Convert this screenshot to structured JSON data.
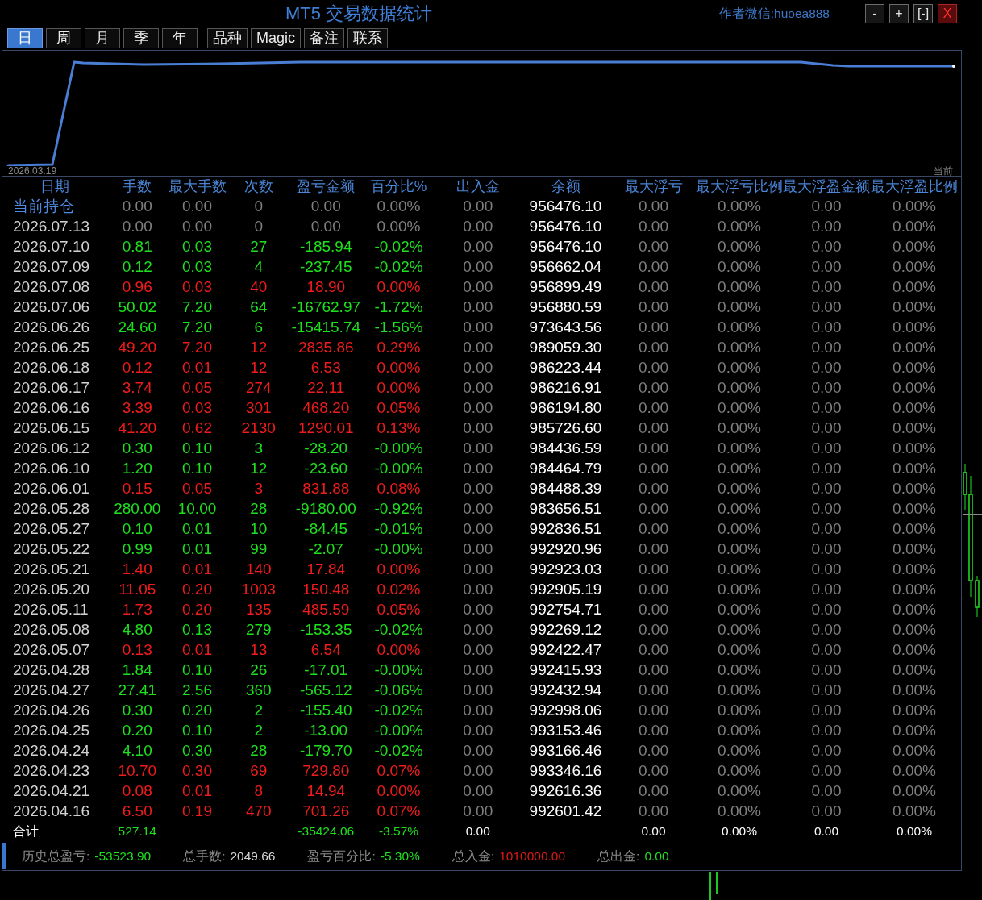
{
  "window": {
    "title": "MT5 交易数据统计",
    "author": "作者微信:huoea888",
    "controls": [
      {
        "label": "-",
        "kind": "minus"
      },
      {
        "label": "+",
        "kind": "plus"
      },
      {
        "label": "[-]",
        "kind": "collapse"
      },
      {
        "label": "X",
        "kind": "close"
      }
    ]
  },
  "period_tabs": [
    {
      "label": "日",
      "selected": true
    },
    {
      "label": "周",
      "selected": false
    },
    {
      "label": "月",
      "selected": false
    },
    {
      "label": "季",
      "selected": false
    },
    {
      "label": "年",
      "selected": false
    }
  ],
  "function_buttons": [
    "品种",
    "Magic",
    "备注",
    "联系"
  ],
  "chart": {
    "start_label": "2026.03.19",
    "end_label": "当前"
  },
  "table": {
    "columns": [
      "日期",
      "手数",
      "最大手数",
      "次数",
      "盈亏金额",
      "百分比%",
      "出入金",
      "余额",
      "最大浮亏",
      "最大浮亏比例",
      "最大浮盈金额",
      "最大浮盈比例"
    ],
    "rows": [
      {
        "kind": "current",
        "color": "#7f7f7f",
        "cells": [
          "当前持仓",
          "0.00",
          "0.00",
          "0",
          "0.00",
          "0.00%",
          "0.00",
          "956476.10",
          "0.00",
          "0.00%",
          "0.00",
          "0.00%"
        ]
      },
      {
        "kind": "day",
        "color": "#7f7f7f",
        "cells": [
          "2026.07.13",
          "0.00",
          "0.00",
          "0",
          "0.00",
          "0.00%",
          "0.00",
          "956476.10",
          "0.00",
          "0.00%",
          "0.00",
          "0.00%"
        ]
      },
      {
        "kind": "day",
        "color": "#1ee01e",
        "cells": [
          "2026.07.10",
          "0.81",
          "0.03",
          "27",
          "-185.94",
          "-0.02%",
          "0.00",
          "956476.10",
          "0.00",
          "0.00%",
          "0.00",
          "0.00%"
        ]
      },
      {
        "kind": "day",
        "color": "#1ee01e",
        "cells": [
          "2026.07.09",
          "0.12",
          "0.03",
          "4",
          "-237.45",
          "-0.02%",
          "0.00",
          "956662.04",
          "0.00",
          "0.00%",
          "0.00",
          "0.00%"
        ]
      },
      {
        "kind": "day",
        "color": "#f01c1c",
        "cells": [
          "2026.07.08",
          "0.96",
          "0.03",
          "40",
          "18.90",
          "0.00%",
          "0.00",
          "956899.49",
          "0.00",
          "0.00%",
          "0.00",
          "0.00%"
        ]
      },
      {
        "kind": "day",
        "color": "#1ee01e",
        "cells": [
          "2026.07.06",
          "50.02",
          "7.20",
          "64",
          "-16762.97",
          "-1.72%",
          "0.00",
          "956880.59",
          "0.00",
          "0.00%",
          "0.00",
          "0.00%"
        ]
      },
      {
        "kind": "day",
        "color": "#1ee01e",
        "cells": [
          "2026.06.26",
          "24.60",
          "7.20",
          "6",
          "-15415.74",
          "-1.56%",
          "0.00",
          "973643.56",
          "0.00",
          "0.00%",
          "0.00",
          "0.00%"
        ]
      },
      {
        "kind": "day",
        "color": "#f01c1c",
        "cells": [
          "2026.06.25",
          "49.20",
          "7.20",
          "12",
          "2835.86",
          "0.29%",
          "0.00",
          "989059.30",
          "0.00",
          "0.00%",
          "0.00",
          "0.00%"
        ]
      },
      {
        "kind": "day",
        "color": "#f01c1c",
        "cells": [
          "2026.06.18",
          "0.12",
          "0.01",
          "12",
          "6.53",
          "0.00%",
          "0.00",
          "986223.44",
          "0.00",
          "0.00%",
          "0.00",
          "0.00%"
        ]
      },
      {
        "kind": "day",
        "color": "#f01c1c",
        "cells": [
          "2026.06.17",
          "3.74",
          "0.05",
          "274",
          "22.11",
          "0.00%",
          "0.00",
          "986216.91",
          "0.00",
          "0.00%",
          "0.00",
          "0.00%"
        ]
      },
      {
        "kind": "day",
        "color": "#f01c1c",
        "cells": [
          "2026.06.16",
          "3.39",
          "0.03",
          "301",
          "468.20",
          "0.05%",
          "0.00",
          "986194.80",
          "0.00",
          "0.00%",
          "0.00",
          "0.00%"
        ]
      },
      {
        "kind": "day",
        "color": "#f01c1c",
        "cells": [
          "2026.06.15",
          "41.20",
          "0.62",
          "2130",
          "1290.01",
          "0.13%",
          "0.00",
          "985726.60",
          "0.00",
          "0.00%",
          "0.00",
          "0.00%"
        ]
      },
      {
        "kind": "day",
        "color": "#1ee01e",
        "cells": [
          "2026.06.12",
          "0.30",
          "0.10",
          "3",
          "-28.20",
          "-0.00%",
          "0.00",
          "984436.59",
          "0.00",
          "0.00%",
          "0.00",
          "0.00%"
        ]
      },
      {
        "kind": "day",
        "color": "#1ee01e",
        "cells": [
          "2026.06.10",
          "1.20",
          "0.10",
          "12",
          "-23.60",
          "-0.00%",
          "0.00",
          "984464.79",
          "0.00",
          "0.00%",
          "0.00",
          "0.00%"
        ]
      },
      {
        "kind": "day",
        "color": "#f01c1c",
        "cells": [
          "2026.06.01",
          "0.15",
          "0.05",
          "3",
          "831.88",
          "0.08%",
          "0.00",
          "984488.39",
          "0.00",
          "0.00%",
          "0.00",
          "0.00%"
        ]
      },
      {
        "kind": "day",
        "color": "#1ee01e",
        "cells": [
          "2026.05.28",
          "280.00",
          "10.00",
          "28",
          "-9180.00",
          "-0.92%",
          "0.00",
          "983656.51",
          "0.00",
          "0.00%",
          "0.00",
          "0.00%"
        ]
      },
      {
        "kind": "day",
        "color": "#1ee01e",
        "cells": [
          "2026.05.27",
          "0.10",
          "0.01",
          "10",
          "-84.45",
          "-0.01%",
          "0.00",
          "992836.51",
          "0.00",
          "0.00%",
          "0.00",
          "0.00%"
        ]
      },
      {
        "kind": "day",
        "color": "#1ee01e",
        "cells": [
          "2026.05.22",
          "0.99",
          "0.01",
          "99",
          "-2.07",
          "-0.00%",
          "0.00",
          "992920.96",
          "0.00",
          "0.00%",
          "0.00",
          "0.00%"
        ]
      },
      {
        "kind": "day",
        "color": "#f01c1c",
        "cells": [
          "2026.05.21",
          "1.40",
          "0.01",
          "140",
          "17.84",
          "0.00%",
          "0.00",
          "992923.03",
          "0.00",
          "0.00%",
          "0.00",
          "0.00%"
        ]
      },
      {
        "kind": "day",
        "color": "#f01c1c",
        "cells": [
          "2026.05.20",
          "11.05",
          "0.20",
          "1003",
          "150.48",
          "0.02%",
          "0.00",
          "992905.19",
          "0.00",
          "0.00%",
          "0.00",
          "0.00%"
        ]
      },
      {
        "kind": "day",
        "color": "#f01c1c",
        "cells": [
          "2026.05.11",
          "1.73",
          "0.20",
          "135",
          "485.59",
          "0.05%",
          "0.00",
          "992754.71",
          "0.00",
          "0.00%",
          "0.00",
          "0.00%"
        ]
      },
      {
        "kind": "day",
        "color": "#1ee01e",
        "cells": [
          "2026.05.08",
          "4.80",
          "0.13",
          "279",
          "-153.35",
          "-0.02%",
          "0.00",
          "992269.12",
          "0.00",
          "0.00%",
          "0.00",
          "0.00%"
        ]
      },
      {
        "kind": "day",
        "color": "#f01c1c",
        "cells": [
          "2026.05.07",
          "0.13",
          "0.01",
          "13",
          "6.54",
          "0.00%",
          "0.00",
          "992422.47",
          "0.00",
          "0.00%",
          "0.00",
          "0.00%"
        ]
      },
      {
        "kind": "day",
        "color": "#1ee01e",
        "cells": [
          "2026.04.28",
          "1.84",
          "0.10",
          "26",
          "-17.01",
          "-0.00%",
          "0.00",
          "992415.93",
          "0.00",
          "0.00%",
          "0.00",
          "0.00%"
        ]
      },
      {
        "kind": "day",
        "color": "#1ee01e",
        "cells": [
          "2026.04.27",
          "27.41",
          "2.56",
          "360",
          "-565.12",
          "-0.06%",
          "0.00",
          "992432.94",
          "0.00",
          "0.00%",
          "0.00",
          "0.00%"
        ]
      },
      {
        "kind": "day",
        "color": "#1ee01e",
        "cells": [
          "2026.04.26",
          "0.30",
          "0.20",
          "2",
          "-155.40",
          "-0.02%",
          "0.00",
          "992998.06",
          "0.00",
          "0.00%",
          "0.00",
          "0.00%"
        ]
      },
      {
        "kind": "day",
        "color": "#1ee01e",
        "cells": [
          "2026.04.25",
          "0.20",
          "0.10",
          "2",
          "-13.00",
          "-0.00%",
          "0.00",
          "993153.46",
          "0.00",
          "0.00%",
          "0.00",
          "0.00%"
        ]
      },
      {
        "kind": "day",
        "color": "#1ee01e",
        "cells": [
          "2026.04.24",
          "4.10",
          "0.30",
          "28",
          "-179.70",
          "-0.02%",
          "0.00",
          "993166.46",
          "0.00",
          "0.00%",
          "0.00",
          "0.00%"
        ]
      },
      {
        "kind": "day",
        "color": "#f01c1c",
        "cells": [
          "2026.04.23",
          "10.70",
          "0.30",
          "69",
          "729.80",
          "0.07%",
          "0.00",
          "993346.16",
          "0.00",
          "0.00%",
          "0.00",
          "0.00%"
        ]
      },
      {
        "kind": "day",
        "color": "#f01c1c",
        "cells": [
          "2026.04.21",
          "0.08",
          "0.01",
          "8",
          "14.94",
          "0.00%",
          "0.00",
          "992616.36",
          "0.00",
          "0.00%",
          "0.00",
          "0.00%"
        ]
      },
      {
        "kind": "day",
        "color": "#f01c1c",
        "cells": [
          "2026.04.16",
          "6.50",
          "0.19",
          "470",
          "701.26",
          "0.07%",
          "0.00",
          "992601.42",
          "0.00",
          "0.00%",
          "0.00",
          "0.00%"
        ]
      }
    ],
    "totals": {
      "color": "#1ee01e",
      "cells": [
        "合计",
        "527.14",
        null,
        null,
        "-35424.06",
        "-3.57%",
        "0.00",
        null,
        "0.00",
        "0.00%",
        "0.00",
        "0.00%"
      ]
    }
  },
  "status_bar": [
    {
      "label": "历史总盈亏:",
      "value": "-53523.90",
      "color": "#1ee01e"
    },
    {
      "label": "总手数:",
      "value": "2049.66",
      "color": "#d6d6d6"
    },
    {
      "label": "盈亏百分比:",
      "value": "-5.30%",
      "color": "#1ee01e"
    },
    {
      "label": "总入金:",
      "value": "1010000.00",
      "color": "#e01818"
    },
    {
      "label": "总出金:",
      "value": "0.00",
      "color": "#1ee01e"
    }
  ]
}
